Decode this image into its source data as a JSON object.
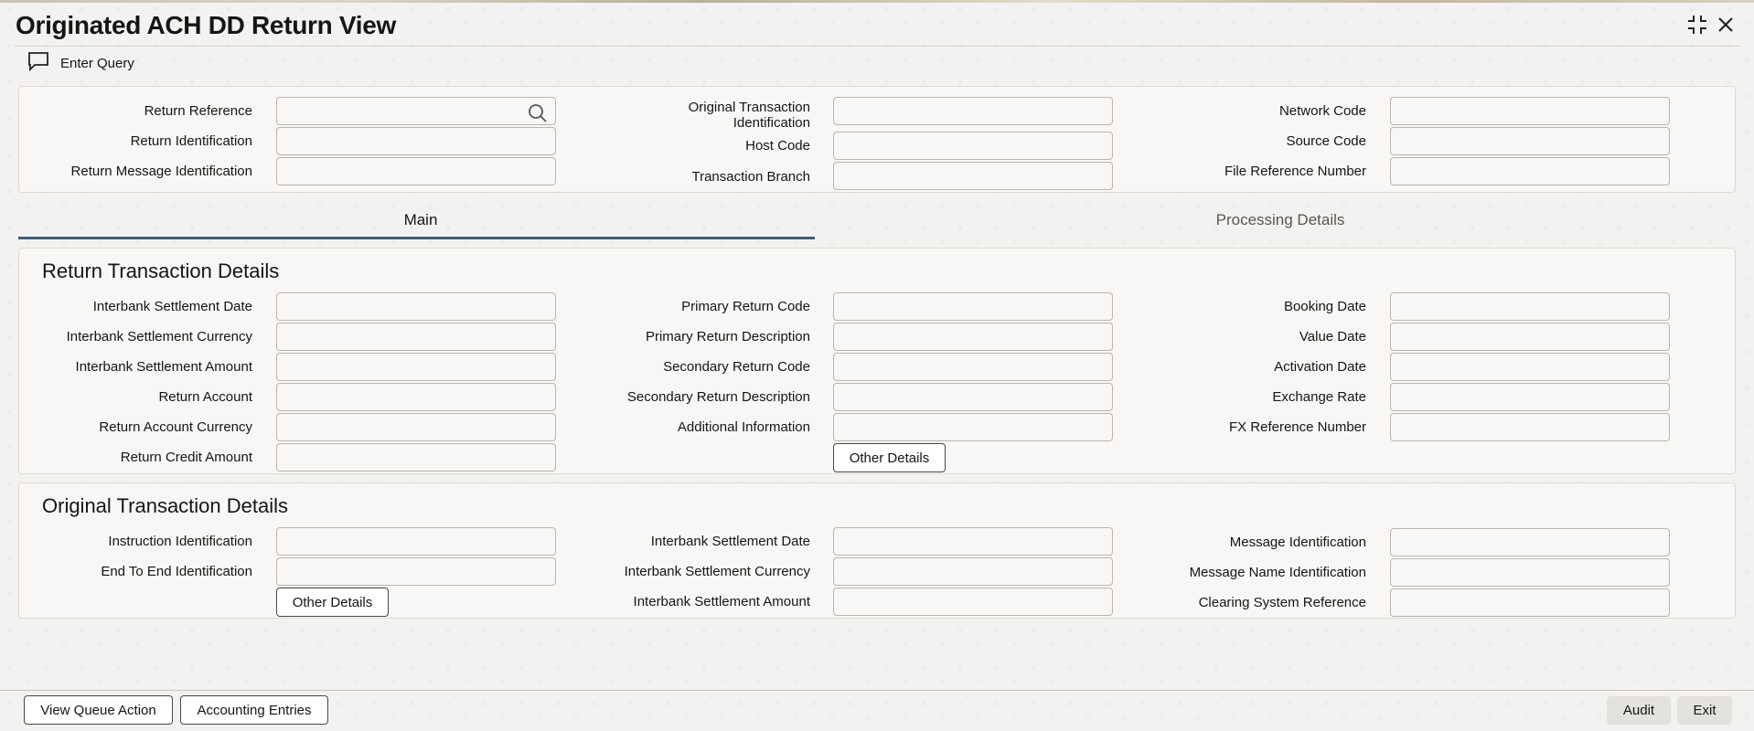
{
  "window": {
    "title": "Originated ACH DD Return View",
    "maximize_icon": "maximize-icon",
    "close_icon": "close-icon"
  },
  "toolbar": {
    "enter_query_label": "Enter Query",
    "enter_query_icon": "chat-bubble-icon"
  },
  "header_fields": {
    "return_reference": "Return Reference",
    "return_identification": "Return Identification",
    "return_message_identification": "Return Message Identification",
    "original_transaction_identification": "Original Transaction Identification",
    "host_code": "Host Code",
    "transaction_branch": "Transaction Branch",
    "network_code": "Network Code",
    "source_code": "Source Code",
    "file_reference_number": "File Reference Number"
  },
  "tabs": {
    "main": "Main",
    "processing_details": "Processing Details",
    "active": "main"
  },
  "return_transaction": {
    "title": "Return Transaction Details",
    "interbank_settlement_date": "Interbank Settlement Date",
    "interbank_settlement_currency": "Interbank Settlement Currency",
    "interbank_settlement_amount": "Interbank Settlement Amount",
    "return_account": "Return Account",
    "return_account_currency": "Return Account Currency",
    "return_credit_amount": "Return Credit Amount",
    "primary_return_code": "Primary Return Code",
    "primary_return_description": "Primary Return Description",
    "secondary_return_code": "Secondary Return Code",
    "secondary_return_description": "Secondary Return Description",
    "additional_information": "Additional Information",
    "other_details": "Other Details",
    "booking_date": "Booking Date",
    "value_date": "Value Date",
    "activation_date": "Activation Date",
    "exchange_rate": "Exchange Rate",
    "fx_reference_number": "FX Reference Number"
  },
  "original_transaction": {
    "title": "Original Transaction Details",
    "instruction_identification": "Instruction Identification",
    "end_to_end_identification": "End To End Identification",
    "other_details": "Other Details",
    "interbank_settlement_date": "Interbank Settlement Date",
    "interbank_settlement_currency": "Interbank Settlement Currency",
    "interbank_settlement_amount": "Interbank Settlement Amount",
    "message_identification": "Message Identification",
    "message_name_identification": "Message Name Identification",
    "clearing_system_reference": "Clearing System Reference"
  },
  "footer": {
    "view_queue_action": "View Queue Action",
    "accounting_entries": "Accounting Entries",
    "audit": "Audit",
    "exit": "Exit"
  },
  "colors": {
    "accent": "#3f5b7d",
    "background": "#f3f2f0",
    "panel": "#f8f7f5"
  }
}
